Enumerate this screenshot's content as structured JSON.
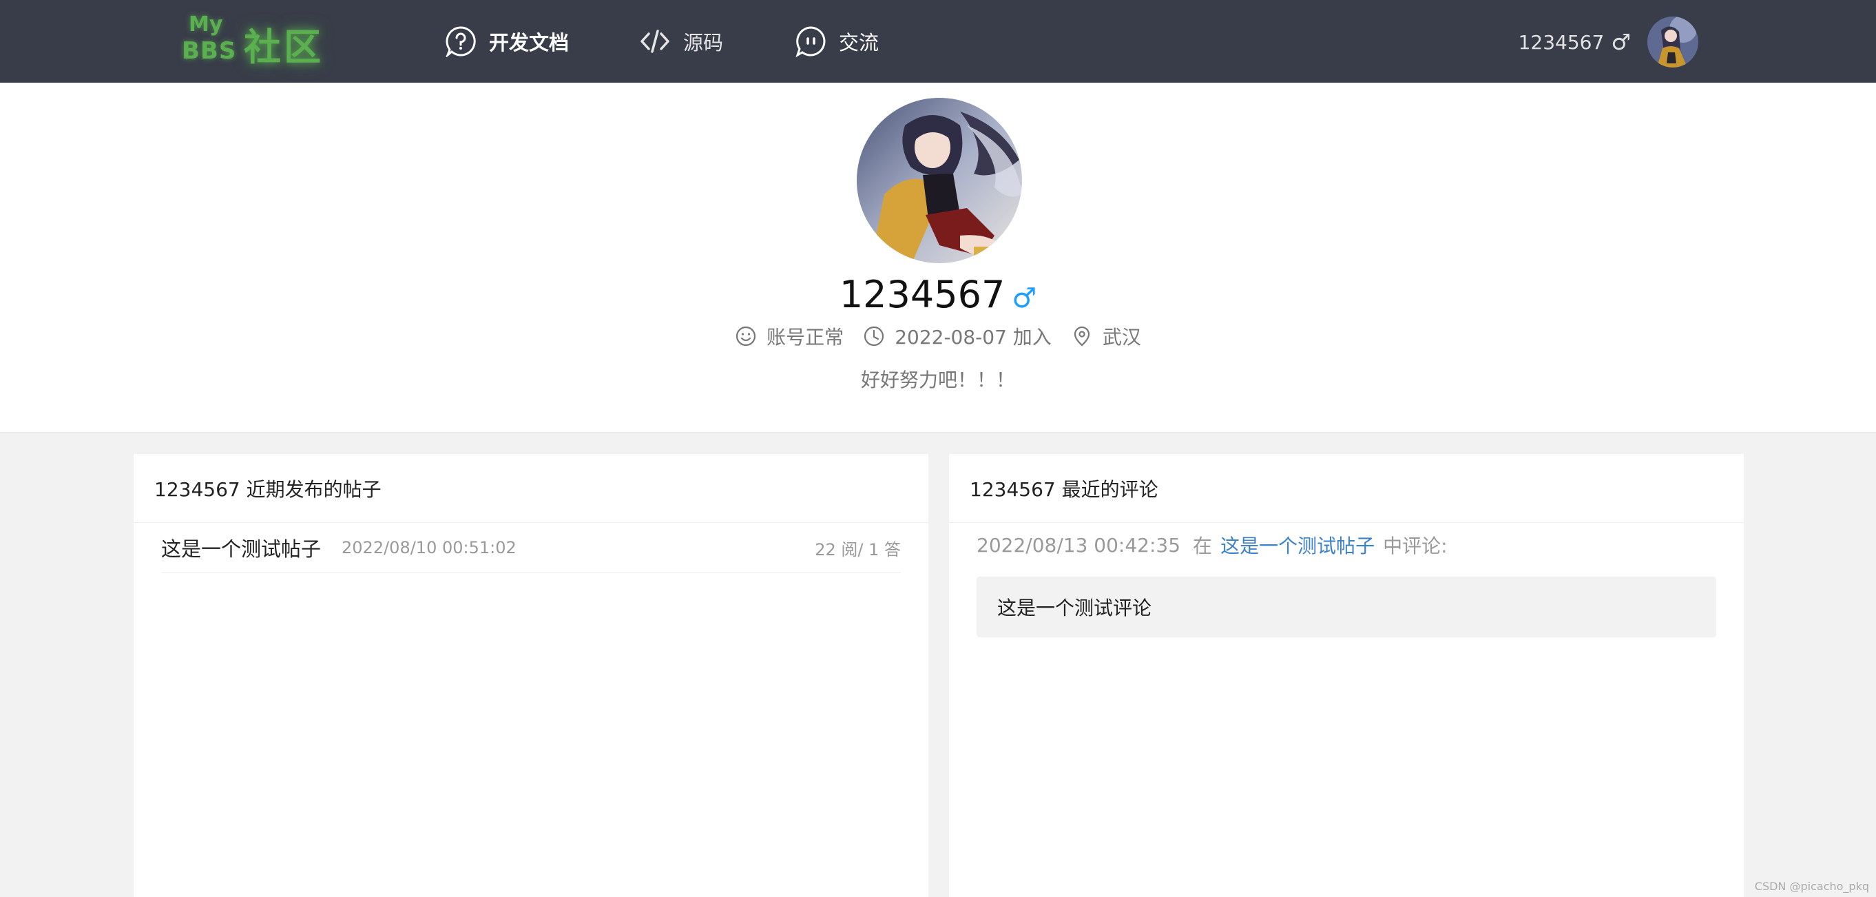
{
  "header": {
    "logo_my": "My",
    "logo_bbs": "BBS",
    "logo_cn": "社区",
    "nav": [
      {
        "label": "开发文档",
        "icon": "question-circle-icon"
      },
      {
        "label": "源码",
        "icon": "code-icon"
      },
      {
        "label": "交流",
        "icon": "chat-bubble-icon"
      }
    ],
    "username": "1234567",
    "sex_symbol": "♂"
  },
  "profile": {
    "name": "1234567",
    "sex_symbol": "♂",
    "status": "账号正常",
    "joined": "2022-08-07 加入",
    "city": "武汉",
    "signature": "好好努力吧！！！"
  },
  "posts_panel": {
    "title": "1234567 近期发布的帖子",
    "posts": [
      {
        "title": "这是一个测试帖子",
        "time": "2022/08/10 00:51:02",
        "stats": "22 阅/ 1 答"
      }
    ]
  },
  "comments_panel": {
    "title": "1234567 最近的评论",
    "comments": [
      {
        "time": "2022/08/13 00:42:35",
        "prefix": "在",
        "post_link": "这是一个测试帖子",
        "suffix": "中评论:",
        "content": "这是一个测试评论"
      }
    ]
  },
  "watermark": "CSDN @picacho_pkq",
  "colors": {
    "header_bg": "#393d49",
    "logo_green": "#5ab04f",
    "link_blue": "#3c82c8",
    "male_blue": "#1e9fff"
  }
}
